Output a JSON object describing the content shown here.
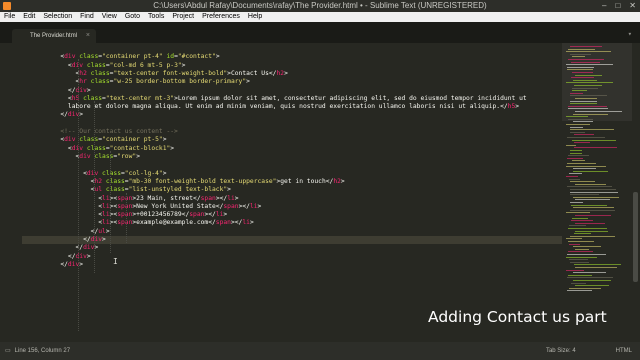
{
  "window": {
    "title": "C:\\Users\\Abdul Rafay\\Documents\\rafay\\The Provider.html • - Sublime Text (UNREGISTERED)",
    "controls": [
      "–",
      "□",
      "✕"
    ]
  },
  "menu": [
    "File",
    "Edit",
    "Selection",
    "Find",
    "View",
    "Goto",
    "Tools",
    "Project",
    "Preferences",
    "Help"
  ],
  "tab": {
    "label": "The Provider.html",
    "close": "×"
  },
  "tabbar_icon": "chevron-down-icon",
  "code": {
    "active_line": 156,
    "lines": [
      {
        "n": "134",
        "tokens": []
      },
      {
        "n": "135",
        "tokens": [
          [
            "x",
            "        <"
          ],
          [
            "t",
            "div"
          ],
          [
            "a",
            " class"
          ],
          [
            "x",
            "="
          ],
          [
            "s",
            "\"container pt-4\""
          ],
          [
            "a",
            " id"
          ],
          [
            "x",
            "="
          ],
          [
            "s",
            "\"#contact\""
          ],
          [
            "x",
            ">"
          ]
        ]
      },
      {
        "n": "136",
        "tokens": [
          [
            "x",
            "          <"
          ],
          [
            "t",
            "div"
          ],
          [
            "a",
            " class"
          ],
          [
            "x",
            "="
          ],
          [
            "s",
            "\"col-md 6 mt-5 p-3\""
          ],
          [
            "x",
            ">"
          ]
        ]
      },
      {
        "n": "137",
        "tokens": [
          [
            "x",
            "            <"
          ],
          [
            "t",
            "h2"
          ],
          [
            "a",
            " class"
          ],
          [
            "x",
            "="
          ],
          [
            "s",
            "\"text-center font-weight-bold\""
          ],
          [
            "x",
            ">Contact Us</"
          ],
          [
            "t",
            "h2"
          ],
          [
            "x",
            ">"
          ]
        ]
      },
      {
        "n": "138",
        "tokens": [
          [
            "x",
            "            <"
          ],
          [
            "t",
            "hr"
          ],
          [
            "a",
            " class"
          ],
          [
            "x",
            "="
          ],
          [
            "s",
            "\"w-25 border-bottom border-primary\""
          ],
          [
            "x",
            ">"
          ]
        ]
      },
      {
        "n": "139",
        "tokens": [
          [
            "x",
            "          </"
          ],
          [
            "t",
            "div"
          ],
          [
            "x",
            ">"
          ]
        ]
      },
      {
        "n": "140",
        "tokens": [
          [
            "x",
            "          <"
          ],
          [
            "t",
            "h5"
          ],
          [
            "a",
            " class"
          ],
          [
            "x",
            "="
          ],
          [
            "s",
            "\"text-center mt-3\""
          ],
          [
            "x",
            ">Lorem ipsum dolor sit amet, consectetur adipiscing elit, sed do eiusmod tempor incididunt ut"
          ]
        ]
      },
      {
        "n": "",
        "tokens": [
          [
            "x",
            "          labore et dolore magna aliqua. Ut enim ad minim veniam, quis nostrud exercitation ullamco laboris nisi ut aliquip.</"
          ],
          [
            "t",
            "h5"
          ],
          [
            "x",
            ">"
          ]
        ]
      },
      {
        "n": "141",
        "tokens": [
          [
            "x",
            "        </"
          ],
          [
            "t",
            "div"
          ],
          [
            "x",
            ">"
          ]
        ]
      },
      {
        "n": "142",
        "tokens": []
      },
      {
        "n": "143",
        "tokens": [
          [
            "c",
            "        <!-- Our contact us content -->"
          ]
        ]
      },
      {
        "n": "144",
        "tokens": [
          [
            "x",
            "        <"
          ],
          [
            "t",
            "div"
          ],
          [
            "a",
            " class"
          ],
          [
            "x",
            "="
          ],
          [
            "s",
            "\"container pt-5\""
          ],
          [
            "x",
            ">"
          ]
        ]
      },
      {
        "n": "145",
        "tokens": [
          [
            "x",
            "          <"
          ],
          [
            "t",
            "div"
          ],
          [
            "a",
            " class"
          ],
          [
            "x",
            "="
          ],
          [
            "s",
            "\"contact-block1\""
          ],
          [
            "x",
            ">"
          ]
        ]
      },
      {
        "n": "146",
        "tokens": [
          [
            "x",
            "            <"
          ],
          [
            "t",
            "div"
          ],
          [
            "a",
            " class"
          ],
          [
            "x",
            "="
          ],
          [
            "s",
            "\"row\""
          ],
          [
            "x",
            ">"
          ]
        ]
      },
      {
        "n": "147",
        "tokens": []
      },
      {
        "n": "148",
        "tokens": [
          [
            "x",
            "              <"
          ],
          [
            "t",
            "div"
          ],
          [
            "a",
            " class"
          ],
          [
            "x",
            "="
          ],
          [
            "s",
            "\"col-lg-4\""
          ],
          [
            "x",
            ">"
          ]
        ]
      },
      {
        "n": "149",
        "tokens": [
          [
            "x",
            "                <"
          ],
          [
            "t",
            "h2"
          ],
          [
            "a",
            " class"
          ],
          [
            "x",
            "="
          ],
          [
            "s",
            "\"mb-30 font-weight-bold text-uppercase\""
          ],
          [
            "x",
            ">get in touch</"
          ],
          [
            "t",
            "h2"
          ],
          [
            "x",
            ">"
          ]
        ]
      },
      {
        "n": "150",
        "tokens": [
          [
            "x",
            "                <"
          ],
          [
            "t",
            "ul"
          ],
          [
            "a",
            " class"
          ],
          [
            "x",
            "="
          ],
          [
            "s",
            "\"list-unstyled text-black\""
          ],
          [
            "x",
            ">"
          ]
        ]
      },
      {
        "n": "151",
        "tokens": [
          [
            "x",
            "                  <"
          ],
          [
            "t",
            "li"
          ],
          [
            "x",
            "><"
          ],
          [
            "t",
            "span"
          ],
          [
            "x",
            ">23 Main, street</"
          ],
          [
            "t",
            "span"
          ],
          [
            "x",
            "></"
          ],
          [
            "t",
            "li"
          ],
          [
            "x",
            ">"
          ]
        ]
      },
      {
        "n": "152",
        "tokens": [
          [
            "x",
            "                  <"
          ],
          [
            "t",
            "li"
          ],
          [
            "x",
            "><"
          ],
          [
            "t",
            "span"
          ],
          [
            "x",
            ">New York United State</"
          ],
          [
            "t",
            "span"
          ],
          [
            "x",
            "></"
          ],
          [
            "t",
            "li"
          ],
          [
            "x",
            ">"
          ]
        ]
      },
      {
        "n": "153",
        "tokens": [
          [
            "x",
            "                  <"
          ],
          [
            "t",
            "li"
          ],
          [
            "x",
            "><"
          ],
          [
            "t",
            "span"
          ],
          [
            "x",
            ">+00123456789</"
          ],
          [
            "t",
            "span"
          ],
          [
            "x",
            "></"
          ],
          [
            "t",
            "li"
          ],
          [
            "x",
            ">"
          ]
        ]
      },
      {
        "n": "154",
        "tokens": [
          [
            "x",
            "                  <"
          ],
          [
            "t",
            "li"
          ],
          [
            "x",
            "><"
          ],
          [
            "t",
            "span"
          ],
          [
            "x",
            ">example@example.com</"
          ],
          [
            "t",
            "span"
          ],
          [
            "x",
            "></"
          ],
          [
            "t",
            "li"
          ],
          [
            "x",
            ">"
          ]
        ]
      },
      {
        "n": "155",
        "tokens": [
          [
            "x",
            "                </"
          ],
          [
            "t",
            "ul"
          ],
          [
            "x",
            ">"
          ]
        ]
      },
      {
        "n": "156",
        "tokens": [
          [
            "x",
            "              </"
          ],
          [
            "t",
            "div"
          ],
          [
            "x",
            ">"
          ]
        ]
      },
      {
        "n": "157",
        "tokens": [
          [
            "x",
            "            </"
          ],
          [
            "t",
            "div"
          ],
          [
            "x",
            ">"
          ]
        ]
      },
      {
        "n": "158",
        "tokens": [
          [
            "x",
            "          </"
          ],
          [
            "t",
            "div"
          ],
          [
            "x",
            ">"
          ]
        ]
      },
      {
        "n": "159",
        "tokens": [
          [
            "x",
            "        </"
          ],
          [
            "t",
            "div"
          ],
          [
            "x",
            ">"
          ]
        ]
      },
      {
        "n": "160",
        "tokens": []
      },
      {
        "n": "161",
        "tokens": []
      },
      {
        "n": "162",
        "tokens": []
      },
      {
        "n": "163",
        "tokens": []
      },
      {
        "n": "164",
        "tokens": []
      },
      {
        "n": "165",
        "tokens": []
      },
      {
        "n": "166",
        "tokens": []
      },
      {
        "n": "167",
        "tokens": []
      },
      {
        "n": "168",
        "tokens": []
      },
      {
        "n": "169",
        "tokens": []
      },
      {
        "n": "170",
        "tokens": []
      }
    ]
  },
  "status": {
    "position": "Line 156, Column 27",
    "tab_size": "Tab Size: 4",
    "syntax": "HTML"
  },
  "caption": "Adding Contact us part",
  "colors": {
    "background": "#272822",
    "tag": "#f92672",
    "attribute": "#a6e22e",
    "string": "#e6db74",
    "comment": "#75715e",
    "text": "#f8f8f2"
  }
}
